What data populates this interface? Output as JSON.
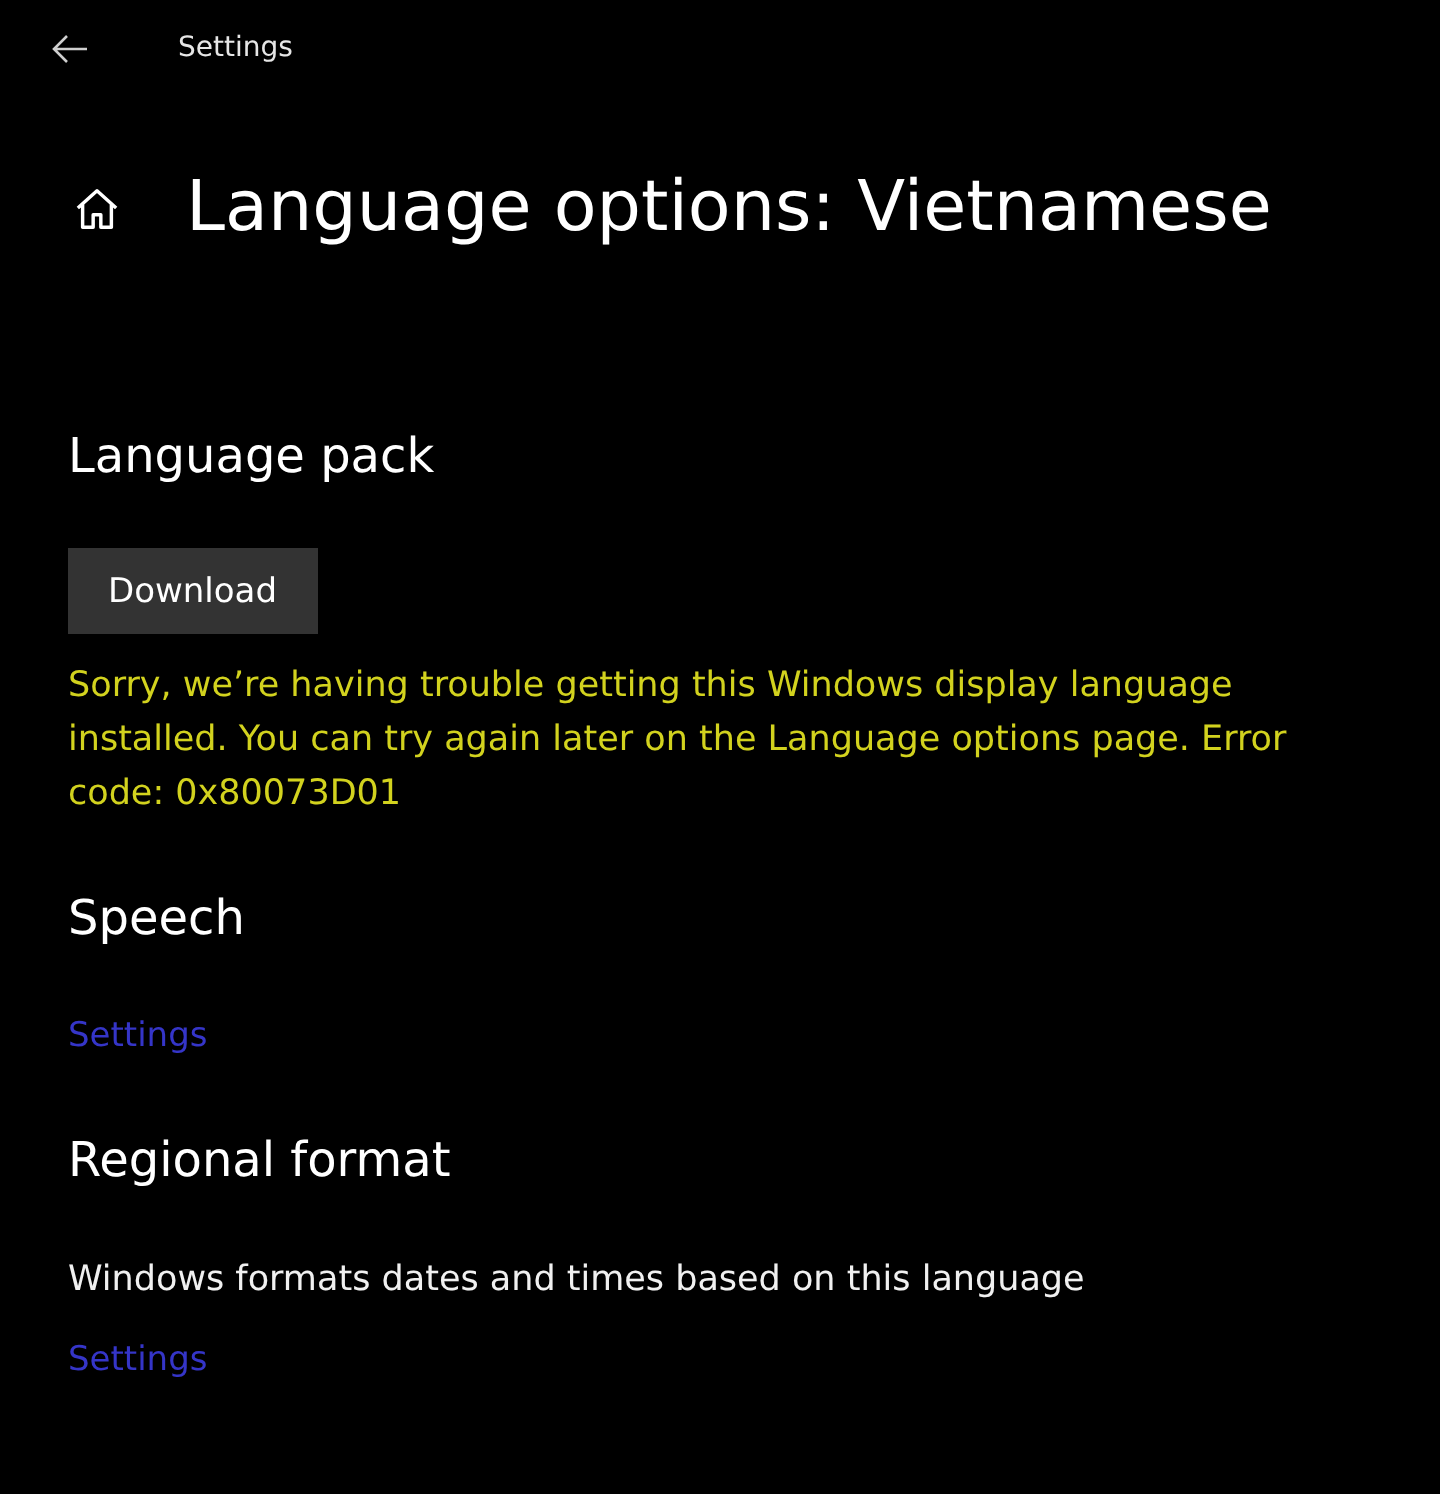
{
  "window": {
    "title": "Settings"
  },
  "page": {
    "title": "Language options: Vietnamese"
  },
  "sections": [
    {
      "title": "Language pack",
      "items": [
        {
          "kind": "button",
          "text": "Download"
        },
        {
          "kind": "error",
          "text": "Sorry, we’re having trouble getting this Windows display language installed. You can try again later on the Language options page. Error code: 0x80073D01"
        }
      ]
    },
    {
      "title": "Speech",
      "items": [
        {
          "kind": "link",
          "text": "Settings"
        }
      ]
    },
    {
      "title": "Regional format",
      "items": [
        {
          "kind": "text",
          "text": "Windows formats dates and times based on this language"
        },
        {
          "kind": "link",
          "text": "Settings"
        }
      ]
    }
  ]
}
